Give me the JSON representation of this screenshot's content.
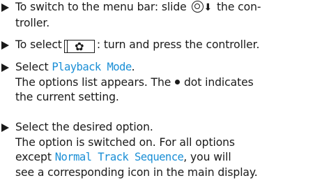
{
  "steps": [
    {
      "t1": "To switch to the menu bar: slide",
      "t2": "the con-",
      "t3": "troller."
    },
    {
      "t1": "To select",
      "t2": ": turn and press the controller."
    },
    {
      "t1": "Select",
      "mono": "Playback Mode",
      "t2": ".",
      "result1": "The options list appears. The",
      "result2": "dot indicates",
      "result3": "the current setting."
    },
    {
      "t1": "Select the desired option.",
      "result1": "The option is switched on. For all options",
      "result2": "except",
      "mono": "Normal Track Sequence",
      "result3": ", you will",
      "result4": "see a corresponding icon in the main display."
    }
  ],
  "icons": {
    "controller": "controller-icon",
    "slide_down": "arrow-down-icon",
    "settings": "gear-icon",
    "bullet": "triangle-bullet-icon",
    "dot": "dot-icon"
  },
  "colors": {
    "text": "#1a1a1a",
    "highlight": "#1b8fd6"
  }
}
